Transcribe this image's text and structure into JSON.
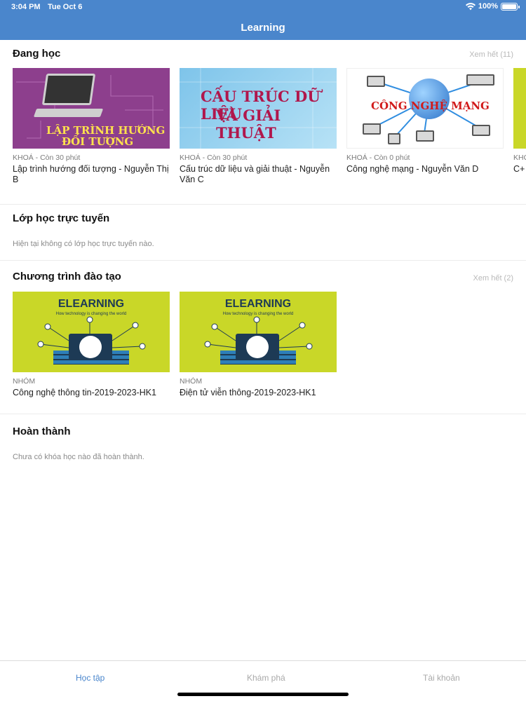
{
  "status_bar": {
    "time": "3:04 PM",
    "date": "Tue Oct 6",
    "battery": "100%"
  },
  "nav": {
    "title": "Learning"
  },
  "learning": {
    "title": "Đang học",
    "see_all": "Xem hết (11)",
    "courses": [
      {
        "meta": "KHOÁ - Còn 30 phút",
        "title": "Lập trình hướng đối tượng - Nguyễn Thị B",
        "thumb_line1": "LẬP TRÌNH HƯỚNG",
        "thumb_line2": "ĐỐI TƯỢNG"
      },
      {
        "meta": "KHOÁ - Còn 30 phút",
        "title": "Cấu trúc dữ liệu và giải thuật - Nguyễn Văn C",
        "thumb_line1": "CẤU TRÚC DỮ LIỆU",
        "thumb_line2": "VÀ GIẢI THUẬT"
      },
      {
        "meta": "KHOÁ - Còn 0 phút",
        "title": "Công nghệ mạng - Nguyễn Văn D",
        "thumb_line1": "CÔNG NGHỆ MẠNG"
      },
      {
        "meta": "KHO",
        "title": "C+"
      }
    ]
  },
  "online_classes": {
    "title": "Lớp học trực tuyến",
    "empty": "Hiện tại không có lớp học trực tuyến nào."
  },
  "programs": {
    "title": "Chương trình đào tạo",
    "see_all": "Xem hết (2)",
    "items": [
      {
        "meta": "NHÓM",
        "title": "Công nghệ thông tin-2019-2023-HK1",
        "thumb_title": "ELEARNING",
        "thumb_sub": "How technology is changing the world"
      },
      {
        "meta": "NHÓM",
        "title": "Điện tử viễn thông-2019-2023-HK1",
        "thumb_title": "ELEARNING",
        "thumb_sub": "How technology is changing the world"
      }
    ]
  },
  "completed": {
    "title": "Hoàn thành",
    "empty": "Chưa có khóa học nào đã hoàn thành."
  },
  "tabs": [
    {
      "label": "Học tập",
      "active": true
    },
    {
      "label": "Khám phá",
      "active": false
    },
    {
      "label": "Tài khoản",
      "active": false
    }
  ],
  "colors": {
    "brand": "#4a86cc",
    "inactive_tab": "#a9a9a9"
  }
}
